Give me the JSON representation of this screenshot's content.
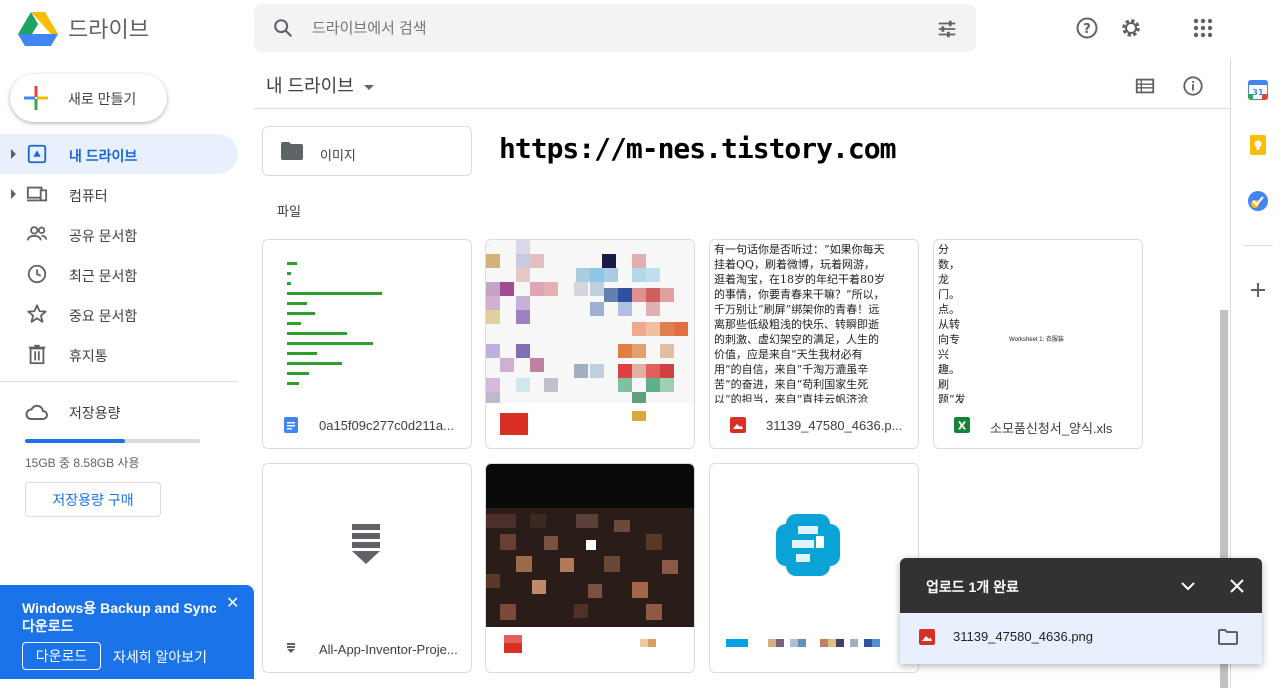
{
  "header": {
    "brand": "드라이브",
    "search_placeholder": "드라이브에서 검색"
  },
  "sidebar": {
    "new_label": "새로 만들기",
    "items": [
      {
        "label": "내 드라이브",
        "icon": "my-drive-icon",
        "active": true
      },
      {
        "label": "컴퓨터",
        "icon": "computer-icon"
      },
      {
        "label": "공유 문서함",
        "icon": "shared-icon"
      },
      {
        "label": "최근 문서함",
        "icon": "clock-icon"
      },
      {
        "label": "중요 문서함",
        "icon": "star-icon"
      },
      {
        "label": "휴지통",
        "icon": "trash-icon"
      }
    ],
    "storage_label": "저장용량",
    "usage_text": "15GB 중 8.58GB 사용",
    "usage_fraction": 0.572,
    "buy_label": "저장용량 구매"
  },
  "promo": {
    "title": "Windows용 Backup and Sync 다운로드",
    "download_label": "다운로드",
    "more_label": "자세히 알아보기"
  },
  "main": {
    "title": "내 드라이브",
    "folder_name": "이미지",
    "watermark": "https://m-nes.tistory.com",
    "files_section": "파일",
    "files": [
      {
        "name": "0a15f09c277c0d211a...",
        "icon": "docs-icon",
        "color": "#4285f4"
      },
      {
        "name": "",
        "icon": "image-icon",
        "color": "#d93025"
      },
      {
        "name": "31139_47580_4636.p...",
        "icon": "image-icon",
        "color": "#d93025"
      },
      {
        "name": "소모품신청서_양식.xls",
        "icon": "sheets-icon",
        "color": "#188038"
      },
      {
        "name": "All-App-Inventor-Proje...",
        "icon": "archive-icon",
        "color": "#5f6368"
      },
      {
        "name": "",
        "icon": "image-icon",
        "color": "#d93025"
      },
      {
        "name": "",
        "icon": "image-icon",
        "color": "#00a1e0"
      }
    ],
    "text_thumb_1": "有一句话你是否听过：“如果你每天挂着QQ，刷着微博，玩着网游，逛着淘宝，在18岁的年纪干着80岁的事情，你要青春来干嘛？”所以，千万别让“刷屏”绑架你的青春！远离那些低级粗浅的快乐、转瞬即逝的刺激、虚幻架空的满足，人生的价值，应是来自“天生我材必有用”的自信，来自“千淘万漉虽辛苦”的奋进，来自“苟利国家生死以”的担当，来自“直挂云帆济沧海”的自豪。",
    "text_thumb_2": "分数，龙门。点。从转向专兴趣。刷题”发的挂坚持、不负青不负这”的新",
    "worksheet_label": "Worksheet 1: 衣服装"
  },
  "upload": {
    "title": "업로드 1개 완료",
    "file": "31139_47580_4636.png"
  },
  "colors": {
    "accent": "#1a73e8",
    "active_bg": "#e8f0fe",
    "promo_bg": "#1a73e8",
    "upload_head": "#323232"
  }
}
